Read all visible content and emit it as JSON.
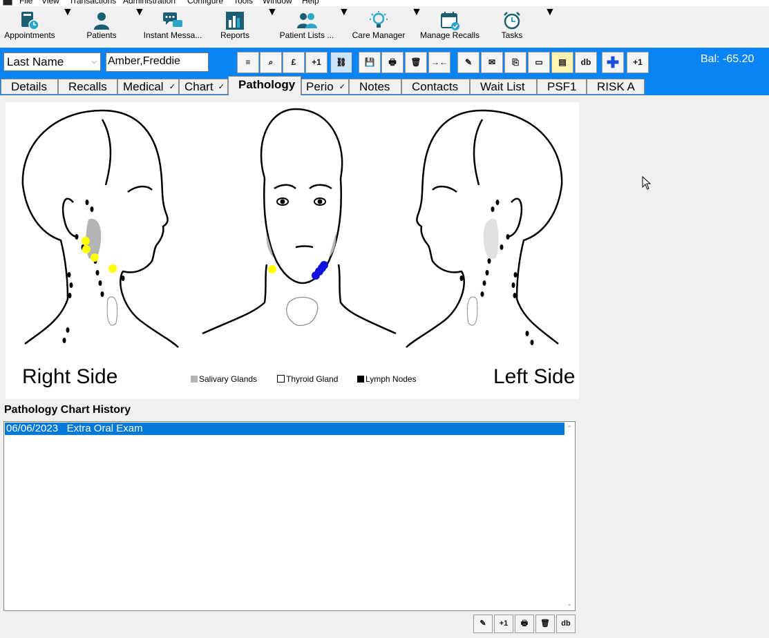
{
  "menu": [
    "File",
    "View",
    "Transactions",
    "Administration",
    "Configure",
    "Tools",
    "Window",
    "Help"
  ],
  "toolbar": [
    {
      "label": "Appointments",
      "icon": "appointments-book-clock-icon",
      "has_dropdown": true
    },
    {
      "label": "Patients",
      "icon": "patient-person-icon",
      "has_dropdown": true
    },
    {
      "label": "Instant Messa...",
      "icon": "chat-bubbles-icon",
      "has_dropdown": false
    },
    {
      "label": "Reports",
      "icon": "bar-chart-icon",
      "has_dropdown": true
    },
    {
      "label": "Patient Lists ...",
      "icon": "people-group-icon",
      "has_dropdown": true
    },
    {
      "label": "Care Manager",
      "icon": "lightbulb-icon",
      "has_dropdown": true
    },
    {
      "label": "Manage Recalls",
      "icon": "calendar-check-icon",
      "has_dropdown": false
    },
    {
      "label": "Tasks",
      "icon": "alarm-clock-icon",
      "has_dropdown": true
    }
  ],
  "search": {
    "field": "Last Name",
    "patient_name": "Amber,Freddie"
  },
  "balance": "Bal: -65.20",
  "patient_buttons": [
    "≡",
    "⌕",
    "£",
    "+1",
    "⛓",
    "💾",
    "🖶",
    "🗑",
    "→←",
    "✎",
    "✉",
    "⎘",
    "▭",
    "▤",
    "db",
    "✚",
    "+1"
  ],
  "tabs": [
    {
      "label": "Details",
      "check": false
    },
    {
      "label": "Recalls",
      "check": false
    },
    {
      "label": "Medical",
      "check": true
    },
    {
      "label": "Chart",
      "check": true
    },
    {
      "label": "Pathology",
      "check": false,
      "active": true
    },
    {
      "label": "Perio",
      "check": true
    },
    {
      "label": "Notes",
      "check": false
    },
    {
      "label": "Contacts",
      "check": false
    },
    {
      "label": "Wait List",
      "check": false
    },
    {
      "label": "PSF1",
      "check": false
    },
    {
      "label": "RISK A",
      "check": false
    }
  ],
  "diagram": {
    "right_label": "Right Side",
    "left_label": "Left Side",
    "legend": [
      "Salivary Glands",
      "Thyroid Gland",
      "Lymph Nodes"
    ],
    "colors": {
      "salivary": "#b4b4b4",
      "marker_yellow": "#ffff00",
      "marker_blue": "#1010e0"
    }
  },
  "history": {
    "title": "Pathology Chart History",
    "rows": [
      {
        "date": "06/06/2023",
        "description": "Extra Oral Exam",
        "selected": true
      }
    ]
  },
  "bottom_buttons": [
    "✎",
    "+1",
    "🖶",
    "🗑",
    "db"
  ]
}
